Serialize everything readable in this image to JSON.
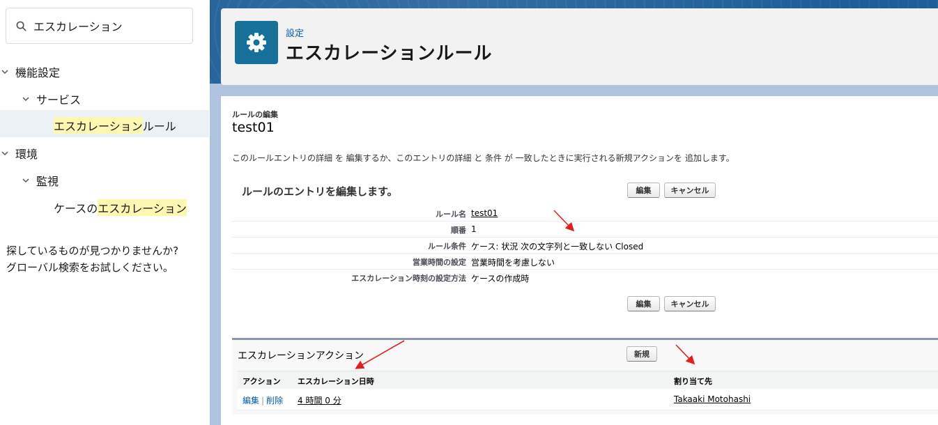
{
  "sidebar": {
    "search": {
      "value": "エスカレーション",
      "placeholder": ""
    },
    "tree": {
      "feature_settings": "機能設定",
      "service": "サービス",
      "escalation_rules": {
        "highlight": "エスカレーション",
        "rest": "ルール"
      },
      "environment": "環境",
      "monitoring": "監視",
      "case_escalation": {
        "prefix": "ケースの",
        "highlight": "エスカレーション"
      }
    },
    "help": {
      "line1": "探しているものが見つかりませんか?",
      "line2": "グローバル検索をお試しください。"
    }
  },
  "header": {
    "breadcrumb": "設定",
    "title": "エスカレーションルール"
  },
  "record": {
    "small_label": "ルールの編集",
    "name": "test01",
    "description": "このルールエントリの詳細 を 編集するか、このエントリの詳細 と 条件 が 一致したときに実行される新規アクションを 追加します。"
  },
  "details": {
    "section_title": "ルールのエントリを編集します。",
    "edit_label": "編集",
    "cancel_label": "キャンセル",
    "rows": [
      {
        "label": "ルール名",
        "value": "test01"
      },
      {
        "label": "順番",
        "value": "1"
      },
      {
        "label": "ルール条件",
        "value": "ケース: 状況 次の文字列と一致しない Closed"
      },
      {
        "label": "営業時間の設定",
        "value": "営業時間を考慮しない"
      },
      {
        "label": "エスカレーション時刻の設定方法",
        "value": "ケースの作成時"
      }
    ]
  },
  "actions": {
    "title": "エスカレーションアクション",
    "new_label": "新規",
    "columns": [
      "アクション",
      "エスカレーション日時",
      "割り当て先"
    ],
    "row": {
      "edit": "編集",
      "separator": "|",
      "delete": "削除",
      "time": "4 時間 0 分",
      "assignee": "Takaaki Motohashi"
    }
  },
  "colors": {
    "brand": "#1d5d98",
    "gear_tile": "#16709a",
    "link": "#015ba7",
    "highlight": "#fcf7b1",
    "annotation_arrow": "#e02020"
  }
}
